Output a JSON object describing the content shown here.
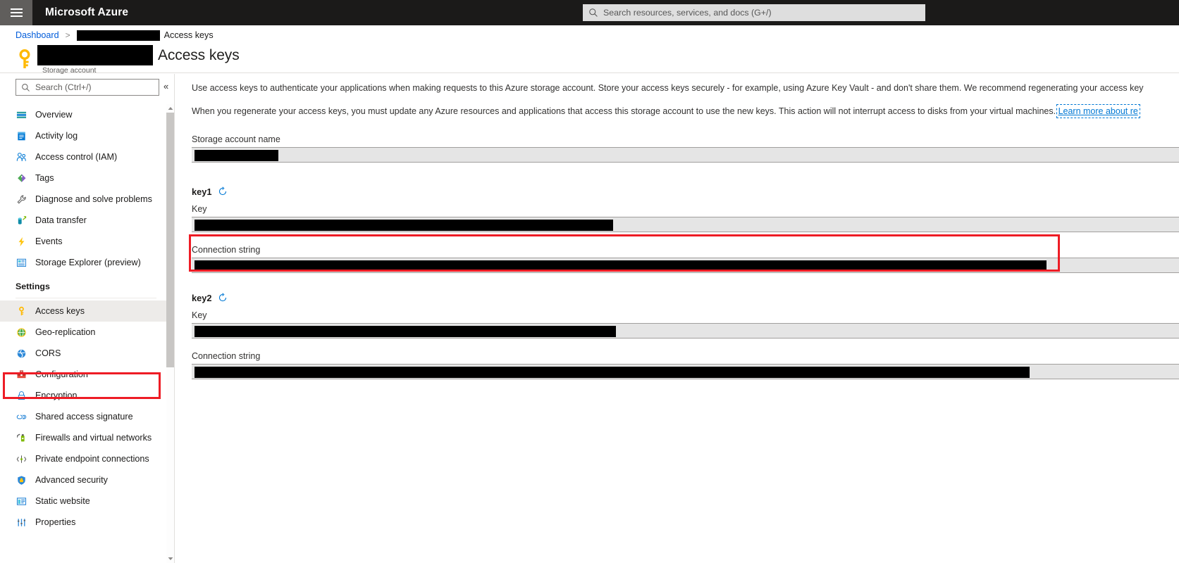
{
  "topbar": {
    "brand": "Microsoft Azure",
    "hamburger_icon": "hamburger-menu-icon",
    "search": {
      "placeholder": "Search resources, services, and docs (G+/)",
      "value": "",
      "icon": "search-icon"
    }
  },
  "breadcrumb": {
    "dashboard": "Dashboard",
    "separator": ">",
    "resource_redacted": "",
    "current": "Access keys"
  },
  "title_row": {
    "resource_icon": "key-icon",
    "resource_name_redacted": "",
    "subtitle": "Storage account",
    "page_title": "Access keys"
  },
  "sidebar": {
    "search": {
      "placeholder": "Search (Ctrl+/)",
      "value": "",
      "icon": "search-icon"
    },
    "collapse_icon": "chevron-double-left-icon",
    "items": [
      {
        "label": "Overview",
        "icon": "overview-icon",
        "selected": false
      },
      {
        "label": "Activity log",
        "icon": "activity-log-icon",
        "selected": false
      },
      {
        "label": "Access control (IAM)",
        "icon": "access-control-icon",
        "selected": false
      },
      {
        "label": "Tags",
        "icon": "tags-icon",
        "selected": false
      },
      {
        "label": "Diagnose and solve problems",
        "icon": "wrench-icon",
        "selected": false
      },
      {
        "label": "Data transfer",
        "icon": "data-transfer-icon",
        "selected": false
      },
      {
        "label": "Events",
        "icon": "lightning-bolt-icon",
        "selected": false
      },
      {
        "label": "Storage Explorer (preview)",
        "icon": "storage-explorer-icon",
        "selected": false
      }
    ],
    "section_label": "Settings",
    "settings_items": [
      {
        "label": "Access keys",
        "icon": "key-icon",
        "selected": true
      },
      {
        "label": "Geo-replication",
        "icon": "globe-icon",
        "selected": false
      },
      {
        "label": "CORS",
        "icon": "cors-icon",
        "selected": false
      },
      {
        "label": "Configuration",
        "icon": "toolbox-icon",
        "selected": false
      },
      {
        "label": "Encryption",
        "icon": "lock-icon",
        "selected": false
      },
      {
        "label": "Shared access signature",
        "icon": "link-icon",
        "selected": false
      },
      {
        "label": "Firewalls and virtual networks",
        "icon": "firewall-icon",
        "selected": false
      },
      {
        "label": "Private endpoint connections",
        "icon": "private-endpoint-icon",
        "selected": false
      },
      {
        "label": "Advanced security",
        "icon": "shield-icon",
        "selected": false
      },
      {
        "label": "Static website",
        "icon": "static-website-icon",
        "selected": false
      },
      {
        "label": "Properties",
        "icon": "properties-icon",
        "selected": false
      }
    ]
  },
  "main": {
    "paragraph1": "Use access keys to authenticate your applications when making requests to this Azure storage account. Store your access keys securely - for example, using Azure Key Vault - and don't share them. We recommend regenerating your access key",
    "paragraph2_before": "When you regenerate your access keys, you must update any Azure resources and applications that access this storage account to use the new keys. This action will not interrupt access to disks from your virtual machines. ",
    "learn_more_link": "Learn more about re",
    "storage_account_name_label": "Storage account name",
    "storage_account_name_value": "",
    "key1": {
      "heading": "key1",
      "regenerate_icon": "regenerate-icon",
      "key_label": "Key",
      "key_value": "",
      "connection_string_label": "Connection string",
      "connection_string_value": ""
    },
    "key2": {
      "heading": "key2",
      "regenerate_icon": "regenerate-icon",
      "key_label": "Key",
      "key_value": "",
      "connection_string_label": "Connection string",
      "connection_string_value": ""
    }
  },
  "annotations": {
    "highlight_color": "#ee1c25",
    "nav_highlight_target": "Access keys",
    "connection_string_highlight_target": "key1 Connection string"
  },
  "colors": {
    "topbar_bg": "#1b1a19",
    "hamburger_bg": "#605e5c",
    "link_blue": "#015cda",
    "accent_blue": "#0078d4",
    "field_bg": "#e5e5e5",
    "selected_bg": "#edebe9",
    "redaction": "#000000"
  }
}
